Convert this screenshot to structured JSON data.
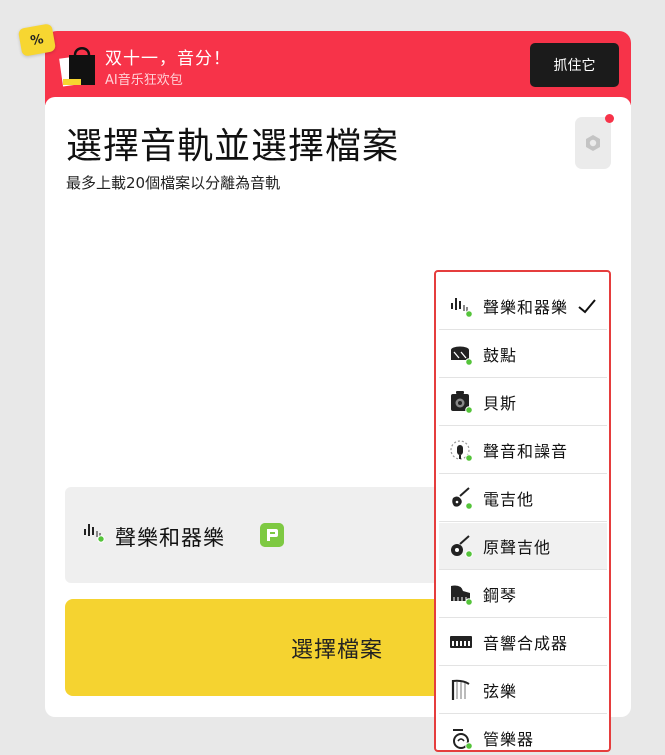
{
  "promo": {
    "tag": "%",
    "title": "双十一，音分！",
    "subtitle": "AI音乐狂欢包",
    "button": "抓住它"
  },
  "card": {
    "title": "選擇音軌並選擇檔案",
    "subtitle": "最多上載20個檔案以分離為音軌"
  },
  "selector": {
    "label": "聲樂和器樂"
  },
  "choose_button": "選擇檔案",
  "dropdown": {
    "items": [
      {
        "label": "聲樂和器樂",
        "icon": "vocal-waveform-icon",
        "selected": true
      },
      {
        "label": "鼓點",
        "icon": "drum-icon"
      },
      {
        "label": "貝斯",
        "icon": "bass-amp-icon"
      },
      {
        "label": "聲音和譟音",
        "icon": "voice-noise-icon"
      },
      {
        "label": "電吉他",
        "icon": "electric-guitar-icon"
      },
      {
        "label": "原聲吉他",
        "icon": "acoustic-guitar-icon",
        "hover": true
      },
      {
        "label": "鋼琴",
        "icon": "piano-icon"
      },
      {
        "label": "音響合成器",
        "icon": "synthesizer-icon"
      },
      {
        "label": "弦樂",
        "icon": "harp-icon"
      },
      {
        "label": "管樂器",
        "icon": "wind-instrument-icon"
      }
    ]
  },
  "colors": {
    "banner": "#f73349",
    "accent_yellow": "#f5d330",
    "status_green": "#55c43b",
    "highlight_border": "#e53d3d"
  }
}
